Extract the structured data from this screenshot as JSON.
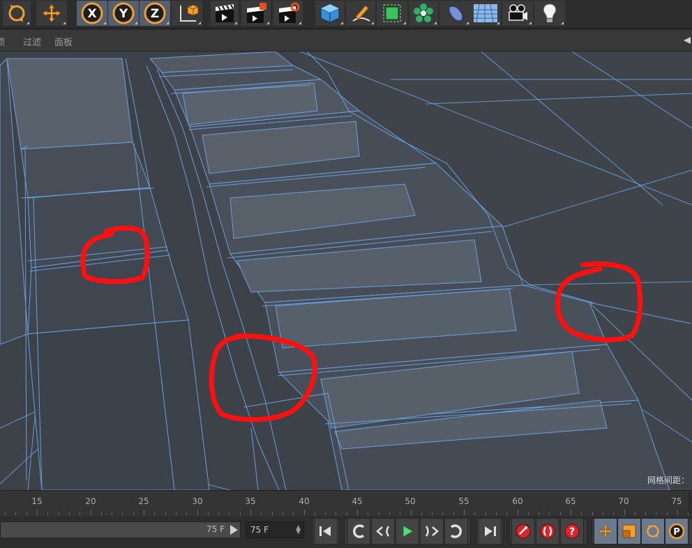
{
  "toolbar": {
    "icons": [
      "rotate-icon",
      "move-icon",
      "x-axis-lock-icon",
      "y-axis-lock-icon",
      "z-axis-lock-icon",
      "world-coordinate-icon",
      "render-view-icon",
      "render-region-icon",
      "render-settings-icon",
      "cube-primitive-icon",
      "pen-spline-icon",
      "subdivision-generator-icon",
      "mograph-cloner-icon",
      "deformer-icon",
      "floor-environment-icon",
      "camera-icon",
      "light-icon"
    ],
    "axis_labels": {
      "x": "X",
      "y": "Y",
      "z": "Z"
    },
    "accent": "#f0a030"
  },
  "menu": {
    "items": [
      "选项",
      "过滤",
      "面板"
    ],
    "visible_items": [
      "项",
      "过滤",
      "面板"
    ]
  },
  "viewport": {
    "grid_info": "网格间距：",
    "background": "#3d4249",
    "wire_color": "#6aa0e0",
    "annotation_color": "#ff1010"
  },
  "timeline": {
    "ticks": [
      "15",
      "20",
      "25",
      "30",
      "35",
      "40",
      "45",
      "50",
      "55",
      "60",
      "65",
      "70",
      "75"
    ]
  },
  "transport": {
    "end_frame_display": "75 F",
    "current_frame_value": "75 F",
    "buttons": [
      "go-to-start-icon",
      "previous-key-icon",
      "previous-frame-icon",
      "play-icon",
      "next-frame-icon",
      "next-key-icon",
      "go-to-end-icon",
      "record-icon",
      "autokey-icon",
      "keyframe-help-icon",
      "move-key-icon",
      "scale-key-icon",
      "rotate-key-icon",
      "param-key-icon"
    ]
  }
}
